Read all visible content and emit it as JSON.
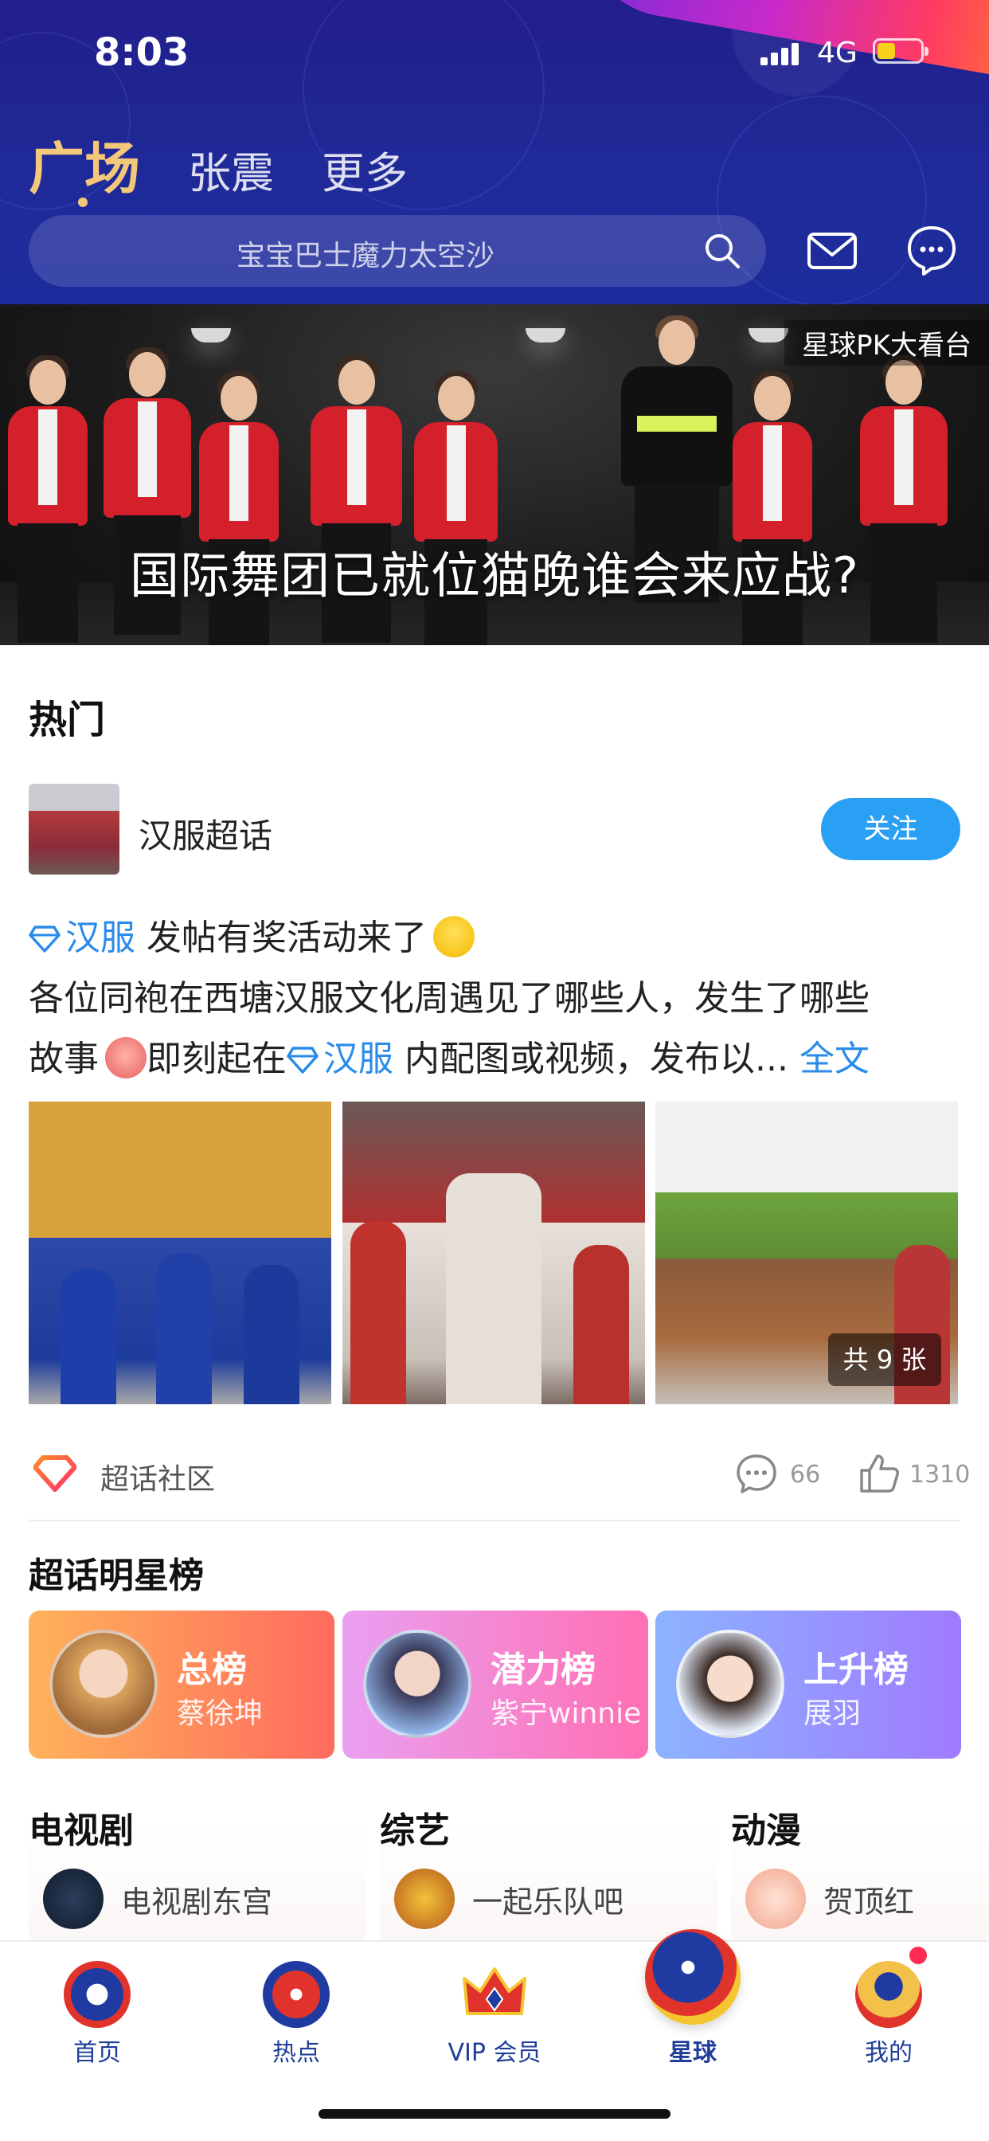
{
  "status_bar": {
    "time": "8:03",
    "network": "4G"
  },
  "header": {
    "tabs": [
      {
        "label": "广场",
        "active": true
      },
      {
        "label": "张震",
        "active": false
      },
      {
        "label": "更多",
        "active": false
      }
    ],
    "search": {
      "placeholder": "宝宝巴士魔力太空沙"
    }
  },
  "banner": {
    "tag": "星球PK大看台",
    "title": "国际舞团已就位猫晚谁会来应战?"
  },
  "hot": {
    "section_title": "热门",
    "topic": {
      "name": "汉服超话",
      "follow_label": "关注"
    },
    "post": {
      "tag1": "汉服",
      "line1_text": " 发帖有奖活动来了",
      "line2": "各位同袍在西塘汉服文化周遇见了哪些人，发生了哪些",
      "line3_a": "故事",
      "line3_b": "即刻起在",
      "tag2": "汉服",
      "line3_c": " 内配图或视频，发布以... ",
      "more_label": "全文"
    },
    "photo_count": "共 9 张",
    "meta": {
      "community": "超话社区",
      "comments": "66",
      "likes": "1310"
    }
  },
  "star_rank": {
    "section_title": "超话明星榜",
    "cards": [
      {
        "title": "总榜",
        "name": "蔡徐坤"
      },
      {
        "title": "潜力榜",
        "name": "紫宁winnie"
      },
      {
        "title": "上升榜",
        "name": "展羽"
      }
    ]
  },
  "categories": [
    {
      "title": "电视剧",
      "item": "电视剧东宫"
    },
    {
      "title": "综艺",
      "item": "一起乐队吧"
    },
    {
      "title": "动漫",
      "item": "贺顶红"
    }
  ],
  "tabbar": [
    {
      "label": "首页"
    },
    {
      "label": "热点"
    },
    {
      "label": "VIP 会员"
    },
    {
      "label": "星球",
      "active": true
    },
    {
      "label": "我的"
    }
  ],
  "colors": {
    "header_bg": "#221e8c",
    "active_tab": "#f4c87a",
    "link_blue": "#2b8bea",
    "follow_button": "#2aa0f5",
    "tabbar_label": "#1e3e9a",
    "badge": "#ff2d55"
  }
}
